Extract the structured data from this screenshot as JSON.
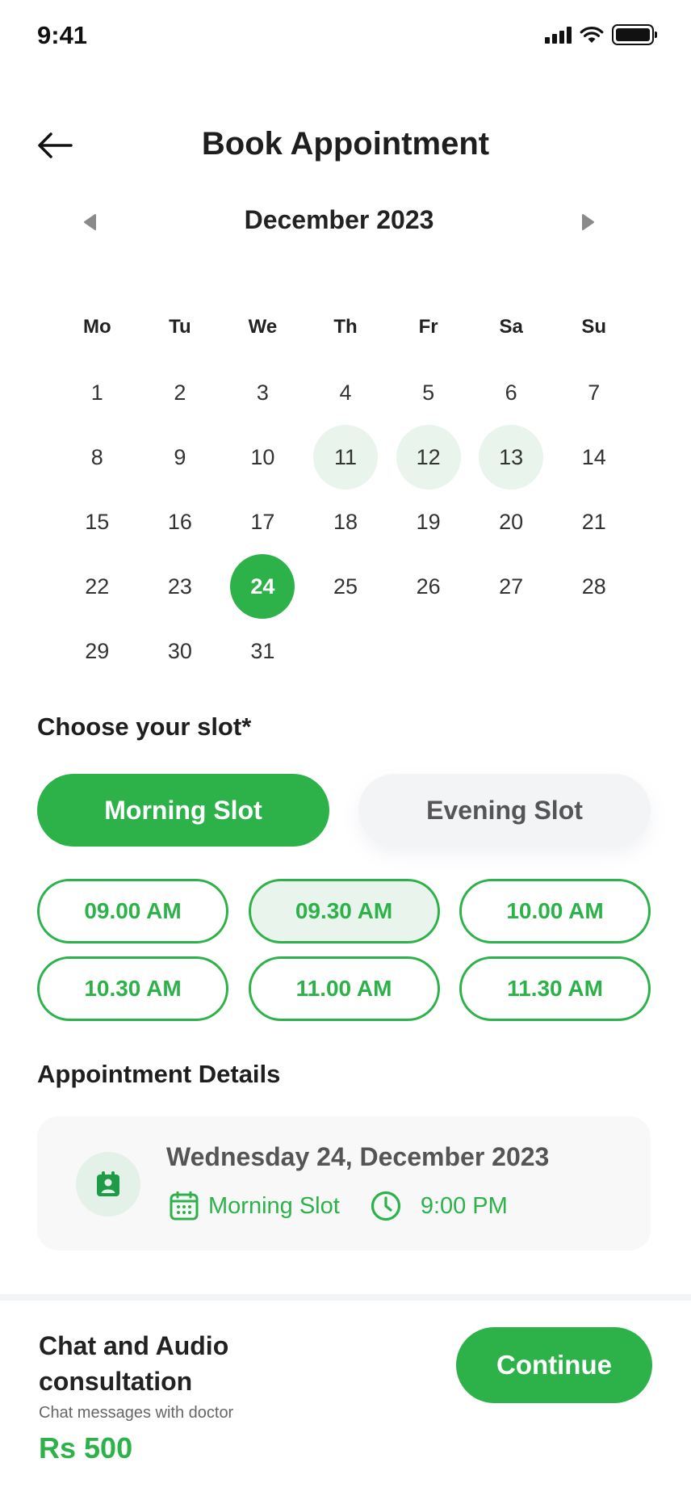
{
  "status_bar": {
    "time": "9:41"
  },
  "header": {
    "title": "Book Appointment",
    "back_icon": "arrow-left-icon"
  },
  "calendar": {
    "month_label": "December 2023",
    "prev_icon": "caret-left-icon",
    "next_icon": "caret-right-icon",
    "weekdays": [
      "Mo",
      "Tu",
      "We",
      "Th",
      "Fr",
      "Sa",
      "Su"
    ],
    "weeks": [
      [
        "1",
        "2",
        "3",
        "4",
        "5",
        "6",
        "7"
      ],
      [
        "8",
        "9",
        "10",
        "11",
        "12",
        "13",
        "14"
      ],
      [
        "15",
        "16",
        "17",
        "18",
        "19",
        "20",
        "21"
      ],
      [
        "22",
        "23",
        "24",
        "25",
        "26",
        "27",
        "28"
      ],
      [
        "29",
        "30",
        "31",
        "",
        "",
        "",
        ""
      ]
    ],
    "highlighted_days": [
      "11",
      "12",
      "13"
    ],
    "selected_day": "24"
  },
  "slots": {
    "section_title": "Choose your slot*",
    "morning_label": "Morning Slot",
    "evening_label": "Evening Slot",
    "active": "morning",
    "times": [
      "09.00 AM",
      "09.30 AM",
      "10.00 AM",
      "10.30 AM",
      "11.00 AM",
      "11.30 AM"
    ],
    "chosen_time": "09.30 AM"
  },
  "details": {
    "section_title": "Appointment Details",
    "date": "Wednesday 24, December 2023",
    "slot": "Morning Slot",
    "time": "9:00 PM",
    "avatar_icon": "calendar-user-icon",
    "slot_icon": "calendar-icon",
    "time_icon": "clock-icon"
  },
  "footer": {
    "title": "Chat and Audio consultation",
    "subtitle": "Chat messages with doctor",
    "price": "Rs 500",
    "continue_label": "Continue"
  },
  "colors": {
    "accent": "#2db24a",
    "accent_light": "#e8f4ec",
    "chip_inactive_bg": "#f3f4f6",
    "card_bg": "#f8f8f8"
  }
}
